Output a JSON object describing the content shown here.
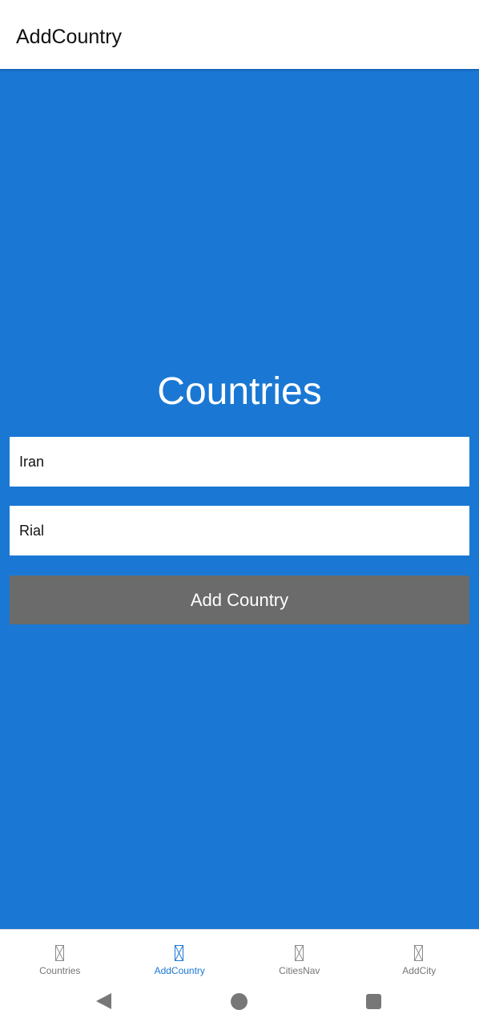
{
  "app_bar": {
    "title": "AddCountry"
  },
  "main": {
    "heading": "Countries",
    "country_field": {
      "value": "Iran"
    },
    "currency_field": {
      "value": "Rial"
    },
    "add_button_label": "Add Country"
  },
  "bottom_nav": {
    "items": [
      {
        "label": "Countries",
        "icon": "missing-glyph-icon"
      },
      {
        "label": "AddCountry",
        "icon": "missing-glyph-icon",
        "active": true
      },
      {
        "label": "CitiesNav",
        "icon": "missing-glyph-icon"
      },
      {
        "label": "AddCity",
        "icon": "missing-glyph-icon"
      }
    ]
  },
  "system_nav": {
    "buttons": [
      "back-icon",
      "home-icon",
      "recents-icon"
    ]
  },
  "colors": {
    "accent": "#1a78d4",
    "button": "#6b6b6b",
    "inactive_nav": "#757575"
  }
}
